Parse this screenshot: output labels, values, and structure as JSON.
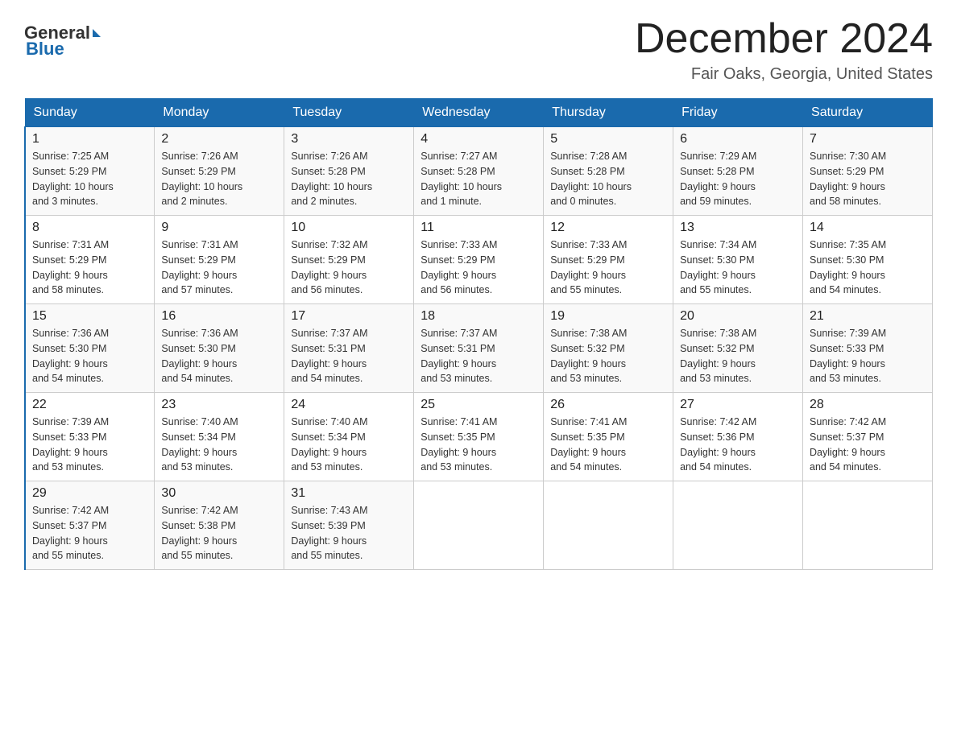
{
  "header": {
    "logo_text_general": "General",
    "logo_text_blue": "Blue",
    "month_year": "December 2024",
    "location": "Fair Oaks, Georgia, United States"
  },
  "calendar": {
    "days_of_week": [
      "Sunday",
      "Monday",
      "Tuesday",
      "Wednesday",
      "Thursday",
      "Friday",
      "Saturday"
    ],
    "weeks": [
      [
        {
          "day": "1",
          "info": "Sunrise: 7:25 AM\nSunset: 5:29 PM\nDaylight: 10 hours\nand 3 minutes."
        },
        {
          "day": "2",
          "info": "Sunrise: 7:26 AM\nSunset: 5:29 PM\nDaylight: 10 hours\nand 2 minutes."
        },
        {
          "day": "3",
          "info": "Sunrise: 7:26 AM\nSunset: 5:28 PM\nDaylight: 10 hours\nand 2 minutes."
        },
        {
          "day": "4",
          "info": "Sunrise: 7:27 AM\nSunset: 5:28 PM\nDaylight: 10 hours\nand 1 minute."
        },
        {
          "day": "5",
          "info": "Sunrise: 7:28 AM\nSunset: 5:28 PM\nDaylight: 10 hours\nand 0 minutes."
        },
        {
          "day": "6",
          "info": "Sunrise: 7:29 AM\nSunset: 5:28 PM\nDaylight: 9 hours\nand 59 minutes."
        },
        {
          "day": "7",
          "info": "Sunrise: 7:30 AM\nSunset: 5:29 PM\nDaylight: 9 hours\nand 58 minutes."
        }
      ],
      [
        {
          "day": "8",
          "info": "Sunrise: 7:31 AM\nSunset: 5:29 PM\nDaylight: 9 hours\nand 58 minutes."
        },
        {
          "day": "9",
          "info": "Sunrise: 7:31 AM\nSunset: 5:29 PM\nDaylight: 9 hours\nand 57 minutes."
        },
        {
          "day": "10",
          "info": "Sunrise: 7:32 AM\nSunset: 5:29 PM\nDaylight: 9 hours\nand 56 minutes."
        },
        {
          "day": "11",
          "info": "Sunrise: 7:33 AM\nSunset: 5:29 PM\nDaylight: 9 hours\nand 56 minutes."
        },
        {
          "day": "12",
          "info": "Sunrise: 7:33 AM\nSunset: 5:29 PM\nDaylight: 9 hours\nand 55 minutes."
        },
        {
          "day": "13",
          "info": "Sunrise: 7:34 AM\nSunset: 5:30 PM\nDaylight: 9 hours\nand 55 minutes."
        },
        {
          "day": "14",
          "info": "Sunrise: 7:35 AM\nSunset: 5:30 PM\nDaylight: 9 hours\nand 54 minutes."
        }
      ],
      [
        {
          "day": "15",
          "info": "Sunrise: 7:36 AM\nSunset: 5:30 PM\nDaylight: 9 hours\nand 54 minutes."
        },
        {
          "day": "16",
          "info": "Sunrise: 7:36 AM\nSunset: 5:30 PM\nDaylight: 9 hours\nand 54 minutes."
        },
        {
          "day": "17",
          "info": "Sunrise: 7:37 AM\nSunset: 5:31 PM\nDaylight: 9 hours\nand 54 minutes."
        },
        {
          "day": "18",
          "info": "Sunrise: 7:37 AM\nSunset: 5:31 PM\nDaylight: 9 hours\nand 53 minutes."
        },
        {
          "day": "19",
          "info": "Sunrise: 7:38 AM\nSunset: 5:32 PM\nDaylight: 9 hours\nand 53 minutes."
        },
        {
          "day": "20",
          "info": "Sunrise: 7:38 AM\nSunset: 5:32 PM\nDaylight: 9 hours\nand 53 minutes."
        },
        {
          "day": "21",
          "info": "Sunrise: 7:39 AM\nSunset: 5:33 PM\nDaylight: 9 hours\nand 53 minutes."
        }
      ],
      [
        {
          "day": "22",
          "info": "Sunrise: 7:39 AM\nSunset: 5:33 PM\nDaylight: 9 hours\nand 53 minutes."
        },
        {
          "day": "23",
          "info": "Sunrise: 7:40 AM\nSunset: 5:34 PM\nDaylight: 9 hours\nand 53 minutes."
        },
        {
          "day": "24",
          "info": "Sunrise: 7:40 AM\nSunset: 5:34 PM\nDaylight: 9 hours\nand 53 minutes."
        },
        {
          "day": "25",
          "info": "Sunrise: 7:41 AM\nSunset: 5:35 PM\nDaylight: 9 hours\nand 53 minutes."
        },
        {
          "day": "26",
          "info": "Sunrise: 7:41 AM\nSunset: 5:35 PM\nDaylight: 9 hours\nand 54 minutes."
        },
        {
          "day": "27",
          "info": "Sunrise: 7:42 AM\nSunset: 5:36 PM\nDaylight: 9 hours\nand 54 minutes."
        },
        {
          "day": "28",
          "info": "Sunrise: 7:42 AM\nSunset: 5:37 PM\nDaylight: 9 hours\nand 54 minutes."
        }
      ],
      [
        {
          "day": "29",
          "info": "Sunrise: 7:42 AM\nSunset: 5:37 PM\nDaylight: 9 hours\nand 55 minutes."
        },
        {
          "day": "30",
          "info": "Sunrise: 7:42 AM\nSunset: 5:38 PM\nDaylight: 9 hours\nand 55 minutes."
        },
        {
          "day": "31",
          "info": "Sunrise: 7:43 AM\nSunset: 5:39 PM\nDaylight: 9 hours\nand 55 minutes."
        },
        {
          "day": "",
          "info": ""
        },
        {
          "day": "",
          "info": ""
        },
        {
          "day": "",
          "info": ""
        },
        {
          "day": "",
          "info": ""
        }
      ]
    ]
  }
}
